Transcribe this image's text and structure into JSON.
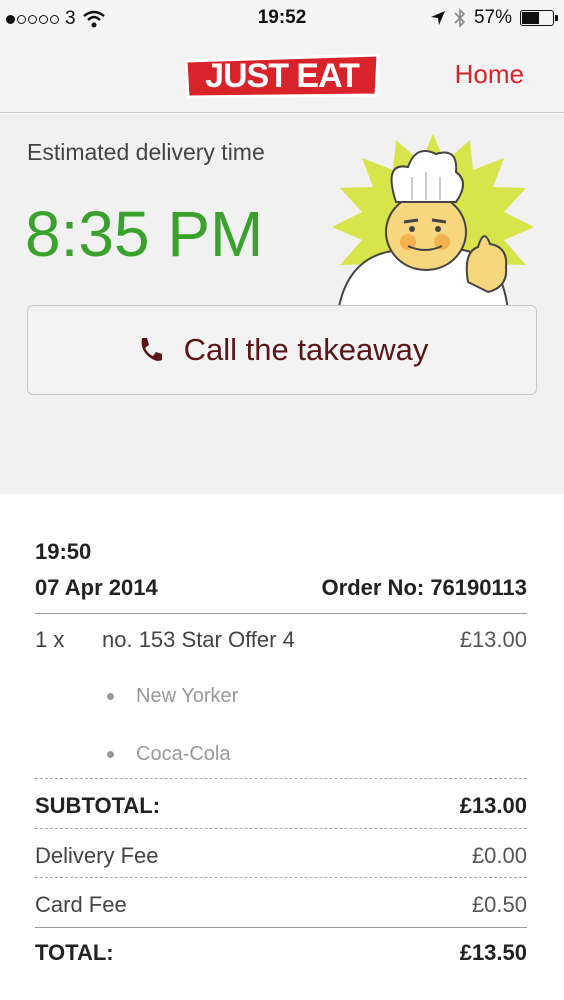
{
  "status_bar": {
    "carrier": "3",
    "time": "19:52",
    "battery": "57%",
    "battery_level": 0.57,
    "signal_bars_filled": 1
  },
  "nav": {
    "logo_text": "JUST EAT",
    "home_label": "Home"
  },
  "delivery": {
    "label": "Estimated delivery time",
    "time": "8:35 PM",
    "call_label": "Call the takeaway"
  },
  "order": {
    "time": "19:50",
    "date": "07 Apr 2014",
    "order_no": "Order No: 76190113",
    "items": [
      {
        "qty": "1 x",
        "name": "no. 153 Star Offer 4",
        "price": "£13.00",
        "options": [
          "New Yorker",
          "Coca-Cola"
        ]
      }
    ],
    "subtotal_label": "SUBTOTAL:",
    "subtotal": "£13.00",
    "delivery_fee_label": "Delivery Fee",
    "delivery_fee": "£0.00",
    "card_fee_label": "Card Fee",
    "card_fee": "£0.50",
    "total_label": "TOTAL:",
    "total": "£13.50"
  },
  "colors": {
    "brand_red": "#d8232a",
    "eta_green": "#3aa12c",
    "call_text": "#5a1616"
  }
}
